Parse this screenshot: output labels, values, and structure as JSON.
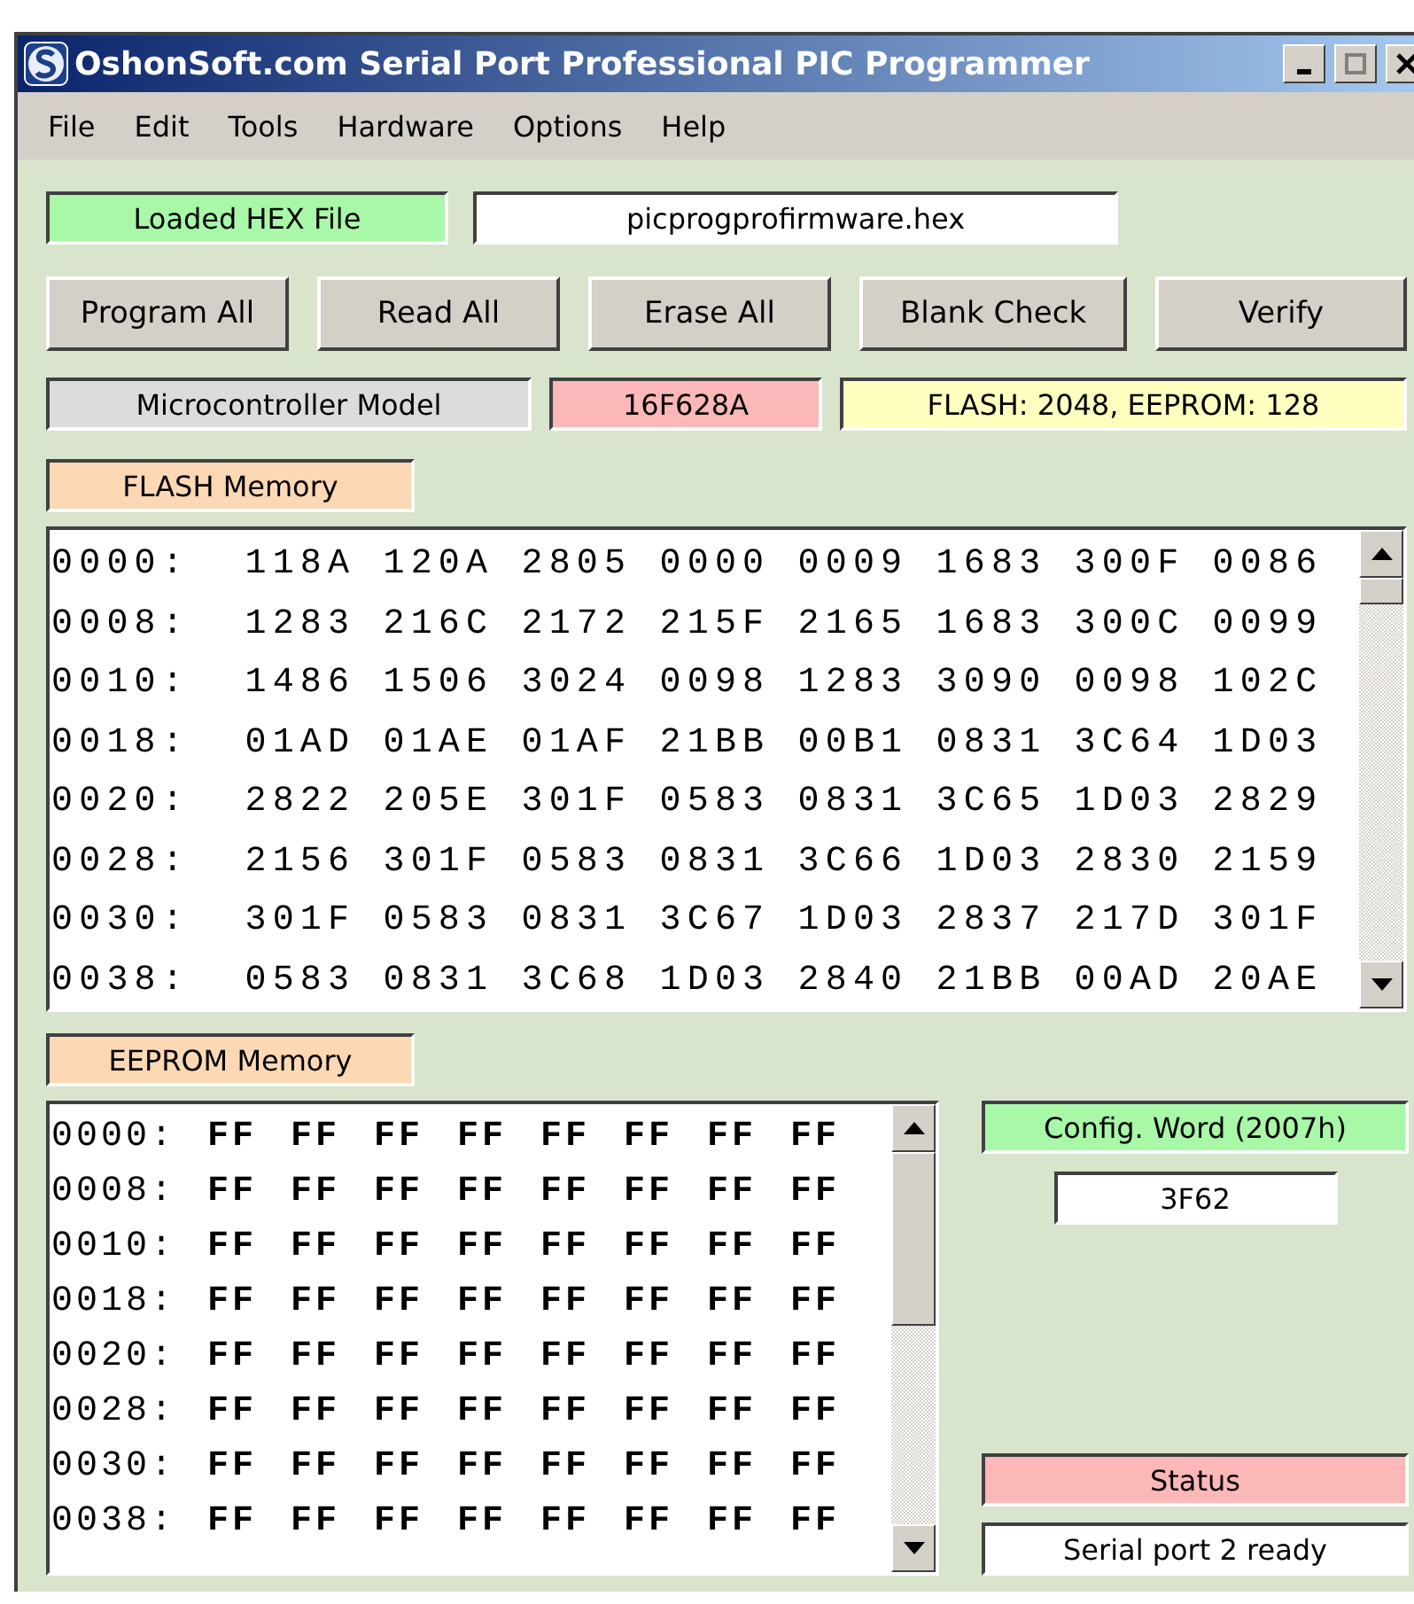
{
  "window": {
    "title": "OshonSoft.com Serial Port Professional PIC Programmer"
  },
  "menu": [
    "File",
    "Edit",
    "Tools",
    "Hardware",
    "Options",
    "Help"
  ],
  "hex_file": {
    "label": "Loaded HEX File",
    "value": "picprogprofirmware.hex"
  },
  "buttons": [
    "Program All",
    "Read All",
    "Erase All",
    "Blank Check",
    "Verify"
  ],
  "model": {
    "label": "Microcontroller Model",
    "value": "16F628A",
    "info": "FLASH: 2048,  EEPROM: 128"
  },
  "flash": {
    "label": "FLASH Memory",
    "rows": [
      "0000:  118A 120A 2805 0000 0009 1683 300F 0086",
      "0008:  1283 216C 2172 215F 2165 1683 300C 0099",
      "0010:  1486 1506 3024 0098 1283 3090 0098 102C",
      "0018:  01AD 01AE 01AF 21BB 00B1 0831 3C64 1D03",
      "0020:  2822 205E 301F 0583 0831 3C65 1D03 2829",
      "0028:  2156 301F 0583 0831 3C66 1D03 2830 2159",
      "0030:  301F 0583 0831 3C67 1D03 2837 217D 301F",
      "0038:  0583 0831 3C68 1D03 2840 21BB 00AD 20AE"
    ]
  },
  "eeprom": {
    "label": "EEPROM Memory",
    "rows": [
      {
        "address": "0000:",
        "bytes": "FF FF FF FF FF FF FF FF"
      },
      {
        "address": "0008:",
        "bytes": "FF FF FF FF FF FF FF FF"
      },
      {
        "address": "0010:",
        "bytes": "FF FF FF FF FF FF FF FF"
      },
      {
        "address": "0018:",
        "bytes": "FF FF FF FF FF FF FF FF"
      },
      {
        "address": "0020:",
        "bytes": "FF FF FF FF FF FF FF FF"
      },
      {
        "address": "0028:",
        "bytes": "FF FF FF FF FF FF FF FF"
      },
      {
        "address": "0030:",
        "bytes": "FF FF FF FF FF FF FF FF"
      },
      {
        "address": "0038:",
        "bytes": "FF FF FF FF FF FF FF FF"
      }
    ]
  },
  "config": {
    "label": "Config. Word (2007h)",
    "value": "3F62"
  },
  "status": {
    "label": "Status",
    "value": "Serial port 2 ready"
  }
}
